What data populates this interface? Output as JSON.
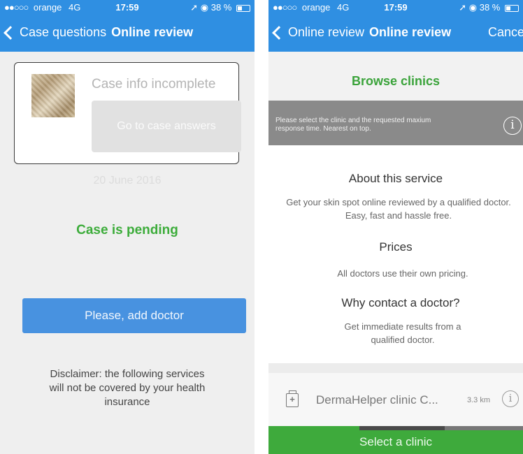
{
  "status_bar": {
    "carrier": "orange",
    "network": "4G",
    "time": "17:59",
    "battery": "38 %"
  },
  "screen1": {
    "nav": {
      "back_label": "Case questions",
      "title": "Online review"
    },
    "case_card": {
      "status": "Case info incomplete",
      "go_button": "Go to case answers"
    },
    "date": "20 June 2016",
    "pending": "Case is pending",
    "add_doctor_button": "Please, add doctor",
    "disclaimer": "Disclaimer: the following services will not be covered by your health insurance"
  },
  "screen2": {
    "nav": {
      "back_label": "Online review",
      "title": "Online review",
      "cancel": "Cancel"
    },
    "browse_label": "Browse clinics",
    "hint": "Please select the clinic and the requested maxium response time. Nearest on top.",
    "sections": [
      {
        "title": "About this service",
        "text": "Get your skin spot online reviewed by a qualified doctor. Easy, fast and hassle free."
      },
      {
        "title": "Prices",
        "text": "All doctors use their own pricing."
      },
      {
        "title": "Why contact a doctor?",
        "text": "Get immediate results from a qualified doctor."
      }
    ],
    "clinic": {
      "name": "DermaHelper clinic C...",
      "distance": "3.3 km"
    },
    "select_button": "Select a clinic"
  },
  "colors": {
    "nav_blue": "#2f8fe2",
    "button_blue": "#4892e0",
    "green": "#3cac3a",
    "hint_gray": "#8a8a8a"
  }
}
